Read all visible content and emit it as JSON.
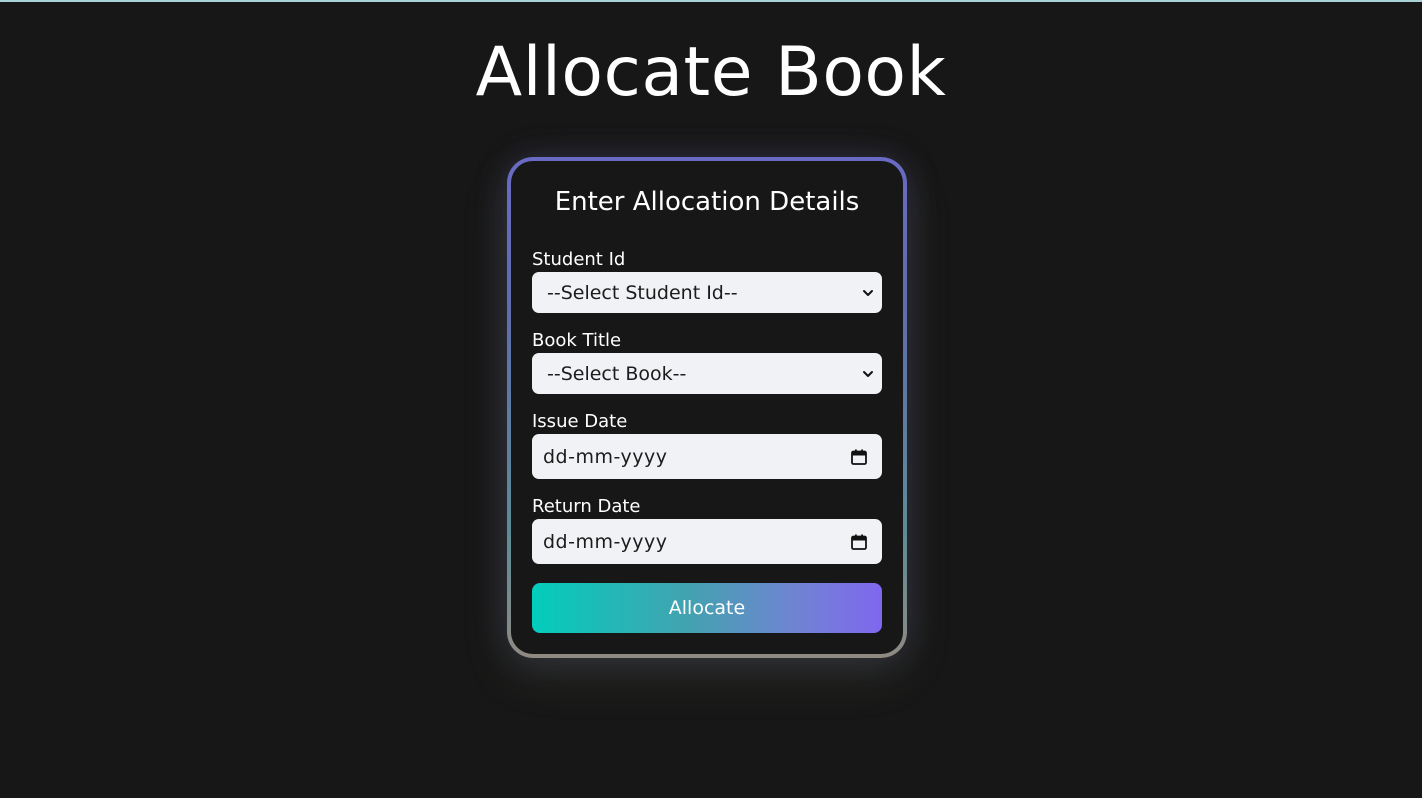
{
  "page": {
    "title": "Allocate Book"
  },
  "form": {
    "title": "Enter Allocation Details",
    "student_id": {
      "label": "Student Id",
      "selected": "--Select Student Id--"
    },
    "book_title": {
      "label": "Book Title",
      "selected": "--Select Book--"
    },
    "issue_date": {
      "label": "Issue Date",
      "placeholder": "dd-mm-yyyy"
    },
    "return_date": {
      "label": "Return Date",
      "placeholder": "dd-mm-yyyy"
    },
    "submit_label": "Allocate"
  },
  "icons": {
    "select_arrow": "chevron-down-icon",
    "date_picker": "calendar-icon"
  },
  "colors": {
    "background": "#171717",
    "button_gradient_start": "#03cdbc",
    "button_gradient_end": "#8067ee",
    "card_border_top": "#6a6ac4",
    "card_border_bottom": "#8f8a82"
  }
}
